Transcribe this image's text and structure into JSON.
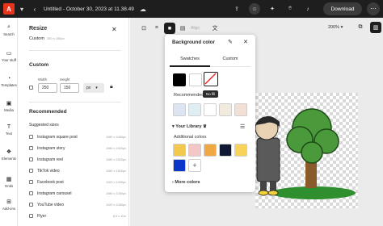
{
  "topbar": {
    "doc_title": "Untitled - October 30, 2023 at 11.38.49",
    "download_label": "Download"
  },
  "rail": {
    "items": [
      {
        "icon": "search-icon",
        "label": "Search"
      },
      {
        "icon": "folder-icon",
        "label": "Your stuff"
      },
      {
        "icon": "templates-icon",
        "label": "Templates"
      },
      {
        "icon": "media-icon",
        "label": "Media"
      },
      {
        "icon": "text-icon",
        "label": "Text"
      },
      {
        "icon": "elements-icon",
        "label": "Elements"
      },
      {
        "icon": "grids-icon",
        "label": "Grids"
      },
      {
        "icon": "addons-icon",
        "label": "Add-ons"
      }
    ]
  },
  "resize_panel": {
    "title": "Resize",
    "current_label": "Custom",
    "current_size": "250 x 150px",
    "custom_heading": "Custom",
    "width_label": "Width",
    "height_label": "Height",
    "width_value": "250",
    "height_value": "150",
    "unit": "px",
    "recommended_heading": "Recommended",
    "suggested_heading": "Suggested sizes",
    "suggestions": [
      {
        "name": "Instagram square post",
        "size": "1080 x 1080px"
      },
      {
        "name": "Instagram story",
        "size": "1080 x 1920px"
      },
      {
        "name": "Instagram reel",
        "size": "1080 x 1920px"
      },
      {
        "name": "TikTok video",
        "size": "1080 x 1920px"
      },
      {
        "name": "Facebook post",
        "size": "1200 x 1200px"
      },
      {
        "name": "Instagram carousel",
        "size": "1080 x 1350px"
      },
      {
        "name": "YouTube video",
        "size": "1920 x 1080px"
      },
      {
        "name": "Flyer",
        "size": "8.5 x 11in"
      }
    ]
  },
  "toolbar": {
    "align_label": "Align",
    "zoom": "200%"
  },
  "bg_popover": {
    "title": "Background color",
    "tab_swatches": "Swatches",
    "tab_custom": "Custom",
    "top_swatches": [
      "#000000",
      "#ffffff",
      "no-fill"
    ],
    "tooltip": "No fill",
    "recommended_label": "Recommended",
    "recommended_swatches": [
      "#dde5f3",
      "#dfeef3",
      "#ffffff",
      "#f1ebdf",
      "#f3dfd6"
    ],
    "library_label": "Your Library",
    "additional_label": "Additional colors",
    "additional_swatches": [
      "#f2c94c",
      "#f4c6c6",
      "#f0a844",
      "#111833",
      "#f7d35a",
      "#0b36c9"
    ],
    "more_colors": "More colors"
  }
}
